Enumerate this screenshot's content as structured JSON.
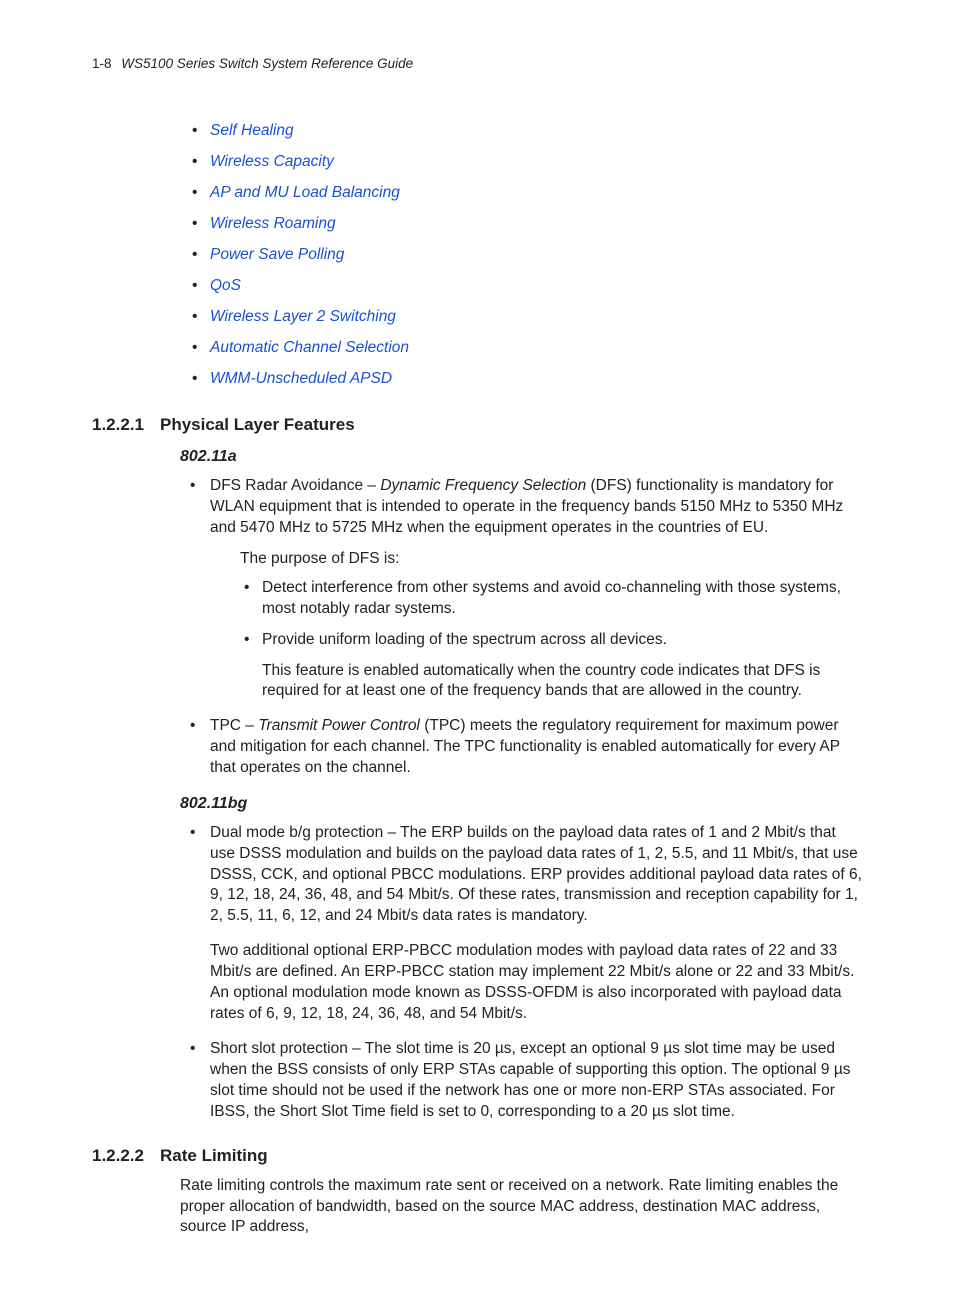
{
  "header": {
    "page_number": "1-8",
    "title": "WS5100 Series Switch System Reference Guide"
  },
  "toc": [
    "Self Healing",
    "Wireless Capacity",
    "AP and MU Load Balancing",
    "Wireless Roaming",
    "Power Save Polling",
    "QoS",
    "Wireless Layer 2 Switching",
    "Automatic Channel Selection",
    "WMM-Unscheduled APSD"
  ],
  "sections": {
    "plf": {
      "number": "1.2.2.1",
      "title": "Physical Layer Features",
      "sub_a": {
        "heading": "802.11a",
        "dfs_prefix": "DFS Radar Avoidance – ",
        "dfs_term": "Dynamic Frequency Selection",
        "dfs_rest": " (DFS) functionality is mandatory for WLAN equipment that is intended to operate in the frequency bands 5150 MHz to 5350 MHz and 5470 MHz to 5725 MHz when the equipment operates in the countries of EU.",
        "dfs_purpose_intro": "The purpose of DFS is:",
        "dfs_points": [
          "Detect interference from other systems and avoid co-channeling with those systems, most notably radar systems.",
          "Provide uniform loading of the spectrum across all devices."
        ],
        "dfs_note": "This feature is enabled automatically when the country code indicates that DFS is required for at least one of the frequency bands that are allowed in the country.",
        "tpc_prefix": "TPC – ",
        "tpc_term": "Transmit Power Control",
        "tpc_rest": " (TPC) meets the regulatory requirement for maximum power and mitigation for each channel. The TPC functionality is enabled automatically for every AP that operates on the channel."
      },
      "sub_bg": {
        "heading": "802.11bg",
        "dual_mode": "Dual mode b/g protection – The ERP builds on the payload data rates of 1 and 2 Mbit/s that use DSSS modulation and builds on the payload data rates of 1, 2, 5.5, and 11 Mbit/s, that use DSSS, CCK, and optional PBCC modulations. ERP provides additional payload data rates of 6, 9, 12, 18, 24, 36, 48, and 54 Mbit/s. Of these rates, transmission and reception capability for 1, 2, 5.5, 11, 6, 12, and 24 Mbit/s data rates is mandatory.",
        "dual_mode_extra": "Two additional optional ERP-PBCC modulation modes with payload data rates of 22 and 33 Mbit/s are defined. An ERP-PBCC station may implement 22 Mbit/s alone or 22 and 33 Mbit/s. An optional modulation mode known as DSSS-OFDM is also incorporated with payload data rates of 6, 9, 12, 18, 24, 36, 48, and 54 Mbit/s.",
        "short_slot": "Short slot protection – The slot time is 20 µs, except an optional 9 µs slot time may be used when the BSS consists of only ERP STAs capable of supporting this option. The optional 9 µs slot time should not be used if the network has one or more non-ERP STAs associated. For IBSS, the Short Slot Time field is set to 0, corresponding to a 20 µs slot time."
      }
    },
    "rate": {
      "number": "1.2.2.2",
      "title": "Rate Limiting",
      "para": "Rate limiting controls the maximum rate sent or received on a network. Rate limiting enables the proper allocation of bandwidth, based on the source MAC address, destination MAC address, source IP address,"
    }
  }
}
